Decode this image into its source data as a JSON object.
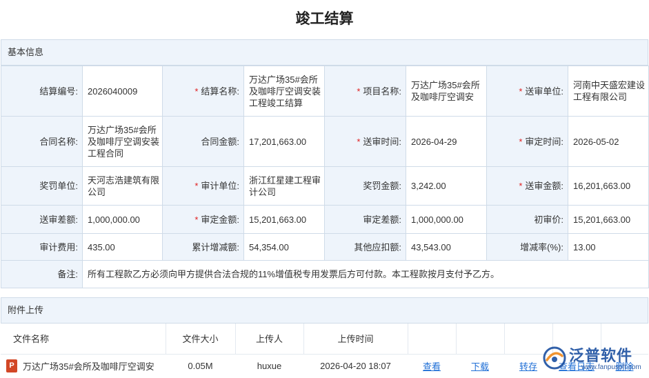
{
  "page": {
    "title": "竣工结算"
  },
  "basic_info": {
    "section_title": "基本信息",
    "rows": [
      [
        {
          "label": "结算编号:",
          "required": false,
          "value": "2026040009"
        },
        {
          "label": "结算名称:",
          "required": true,
          "value": "万达广场35#会所及咖啡厅空调安装工程竣工结算"
        },
        {
          "label": "项目名称:",
          "required": true,
          "value": "万达广场35#会所及咖啡厅空调安"
        },
        {
          "label": "送审单位:",
          "required": true,
          "value": "河南中天盛宏建设工程有限公司"
        }
      ],
      [
        {
          "label": "合同名称:",
          "required": false,
          "value": "万达广场35#会所及咖啡厅空调安装工程合同"
        },
        {
          "label": "合同金额:",
          "required": false,
          "value": "17,201,663.00"
        },
        {
          "label": "送审时间:",
          "required": true,
          "value": "2026-04-29"
        },
        {
          "label": "审定时间:",
          "required": true,
          "value": "2026-05-02"
        }
      ],
      [
        {
          "label": "奖罚单位:",
          "required": false,
          "value": "天河志浩建筑有限公司"
        },
        {
          "label": "审计单位:",
          "required": true,
          "value": "浙江红星建工程审计公司"
        },
        {
          "label": "奖罚金额:",
          "required": false,
          "value": "3,242.00"
        },
        {
          "label": "送审金额:",
          "required": true,
          "value": "16,201,663.00"
        }
      ],
      [
        {
          "label": "送审差额:",
          "required": false,
          "value": "1,000,000.00"
        },
        {
          "label": "审定金额:",
          "required": true,
          "value": "15,201,663.00"
        },
        {
          "label": "审定差额:",
          "required": false,
          "value": "1,000,000.00"
        },
        {
          "label": "初审价:",
          "required": false,
          "value": "15,201,663.00"
        }
      ],
      [
        {
          "label": "审计费用:",
          "required": false,
          "value": "435.00"
        },
        {
          "label": "累计增减额:",
          "required": false,
          "value": "54,354.00"
        },
        {
          "label": "其他应扣额:",
          "required": false,
          "value": "43,543.00"
        },
        {
          "label": "增减率(%):",
          "required": false,
          "value": "13.00"
        }
      ]
    ],
    "remark": {
      "label": "备注:",
      "value": "所有工程款乙方必须向甲方提供合法合规的11%增值税专用发票后方可付款。本工程款按月支付予乙方。"
    }
  },
  "attachments": {
    "section_title": "附件上传",
    "headers": {
      "name": "文件名称",
      "size": "文件大小",
      "uploader": "上传人",
      "time": "上传时间"
    },
    "files": [
      {
        "name": "万达广场35#会所及咖啡厅空调安",
        "size": "0.05M",
        "uploader": "huxue",
        "time": "2026-04-20 18:07",
        "icon": "ppt-file-icon",
        "actions": {
          "view": "查看",
          "download": "下载",
          "save_as": "转存",
          "view_doc": "查看日志",
          "delete": "删除"
        }
      }
    ]
  },
  "watermark": {
    "text": "泛普软件",
    "url": "www.fanpusoft.com"
  },
  "colors": {
    "label_bg": "#eef4fb",
    "border": "#cfdbe8",
    "required": "#e02020",
    "link": "#1f6fd6",
    "brand": "#1b4fa0"
  }
}
